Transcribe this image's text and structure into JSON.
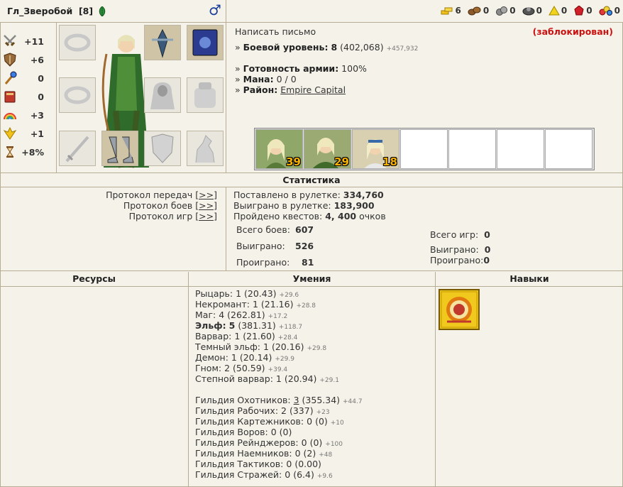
{
  "header": {
    "player_name": "Гл_Зверобой",
    "player_level": "[8]",
    "gender_symbol": "♂",
    "resources": [
      {
        "icon": "gold-icon",
        "value": "6"
      },
      {
        "icon": "wood-icon",
        "value": "0"
      },
      {
        "icon": "ore-icon",
        "value": "0"
      },
      {
        "icon": "mercury-icon",
        "value": "0"
      },
      {
        "icon": "sulfur-icon",
        "value": "0"
      },
      {
        "icon": "crystal-icon",
        "value": "0"
      },
      {
        "icon": "gems-icon",
        "value": "0"
      }
    ]
  },
  "stats": [
    {
      "icon": "attack-icon",
      "value": "+11"
    },
    {
      "icon": "defense-icon",
      "value": "+6"
    },
    {
      "icon": "magic-power-icon",
      "value": "0"
    },
    {
      "icon": "knowledge-icon",
      "value": "0"
    },
    {
      "icon": "luck-icon",
      "value": "+3"
    },
    {
      "icon": "morale-icon",
      "value": "+1"
    },
    {
      "icon": "initiative-icon",
      "value": "+8%"
    }
  ],
  "info": {
    "write_letter": "Написать письмо",
    "blocked": "(заблокирован)",
    "combat_level_label": "Боевой уровень:",
    "combat_level": "8",
    "combat_exp": "(402,068)",
    "combat_exp_next": "+457,932",
    "army_ready_label": "Готовность армии:",
    "army_ready": "100%",
    "mana_label": "Мана:",
    "mana": "0 / 0",
    "district_label": "Район:",
    "district": "Empire Capital",
    "bullet": "»",
    "army": [
      {
        "count": "39"
      },
      {
        "count": "29"
      },
      {
        "count": "18"
      },
      {
        "count": ""
      },
      {
        "count": ""
      },
      {
        "count": ""
      },
      {
        "count": ""
      }
    ]
  },
  "statistics": {
    "title": "Статистика",
    "protocols": [
      {
        "label": "Протокол передач",
        "link": "[>>]"
      },
      {
        "label": "Протокол боев",
        "link": "[>>]"
      },
      {
        "label": "Протокол игр",
        "link": "[>>]"
      }
    ],
    "roulette_bet_label": "Поставлено в рулетке:",
    "roulette_bet": "334,760",
    "roulette_won_label": "Выиграно в рулетке:",
    "roulette_won": "183,900",
    "quests_label": "Пройдено квестов:",
    "quests": "4, 400",
    "quests_suffix": "очков",
    "battles_total_label": "Всего боев:",
    "battles_total": "607",
    "battles_won_label": "Выиграно:",
    "battles_won": "526",
    "battles_lost_label": "Проиграно:",
    "battles_lost": "81",
    "games_total_label": "Всего игр:",
    "games_total": "0",
    "games_won_label": "Выиграно:",
    "games_won": "0",
    "games_lost_label": "Проиграно:",
    "games_lost": "0"
  },
  "sections": {
    "resources": "Ресурсы",
    "skills": "Умения",
    "talents": "Навыки"
  },
  "skills": [
    {
      "name": "Рыцарь:",
      "level": "1",
      "value": "(20.43)",
      "delta": "+29.6",
      "bold": false
    },
    {
      "name": "Некромант:",
      "level": "1",
      "value": "(21.16)",
      "delta": "+28.8",
      "bold": false
    },
    {
      "name": "Маг:",
      "level": "4",
      "value": "(262.81)",
      "delta": "+17.2",
      "bold": false
    },
    {
      "name": "Эльф:",
      "level": "5",
      "value": "(381.31)",
      "delta": "+118.7",
      "bold": true
    },
    {
      "name": "Варвар:",
      "level": "1",
      "value": "(21.60)",
      "delta": "+28.4",
      "bold": false
    },
    {
      "name": "Темный эльф:",
      "level": "1",
      "value": "(20.16)",
      "delta": "+29.8",
      "bold": false
    },
    {
      "name": "Демон:",
      "level": "1",
      "value": "(20.14)",
      "delta": "+29.9",
      "bold": false
    },
    {
      "name": "Гном:",
      "level": "2",
      "value": "(50.59)",
      "delta": "+39.4",
      "bold": false
    },
    {
      "name": "Степной варвар:",
      "level": "1",
      "value": "(20.94)",
      "delta": "+29.1",
      "bold": false
    }
  ],
  "guilds": [
    {
      "name": "Гильдия Охотников:",
      "level": "3",
      "value": "(355.34)",
      "delta": "+44.7",
      "underline": true
    },
    {
      "name": "Гильдия Рабочих:",
      "level": "2",
      "value": "(337)",
      "delta": "+23",
      "underline": false
    },
    {
      "name": "Гильдия Картежников:",
      "level": "0",
      "value": "(0)",
      "delta": "+10",
      "underline": false
    },
    {
      "name": "Гильдия Воров:",
      "level": "0",
      "value": "(0)",
      "delta": "",
      "underline": false
    },
    {
      "name": "Гильдия Рейнджеров:",
      "level": "0",
      "value": "(0)",
      "delta": "+100",
      "underline": false
    },
    {
      "name": "Гильдия Наемников:",
      "level": "0",
      "value": "(2)",
      "delta": "+48",
      "underline": false
    },
    {
      "name": "Гильдия Тактиков:",
      "level": "0",
      "value": "(0.00)",
      "delta": "",
      "underline": false
    },
    {
      "name": "Гильдия Стражей:",
      "level": "0",
      "value": "(6.4)",
      "delta": "+9.6",
      "underline": false
    }
  ],
  "colors": {
    "background": "#f5f3e9",
    "border": "#b7ad95",
    "blocked": "#cc1111",
    "gender": "#1a3e9a",
    "army_count": "#f5b000"
  }
}
